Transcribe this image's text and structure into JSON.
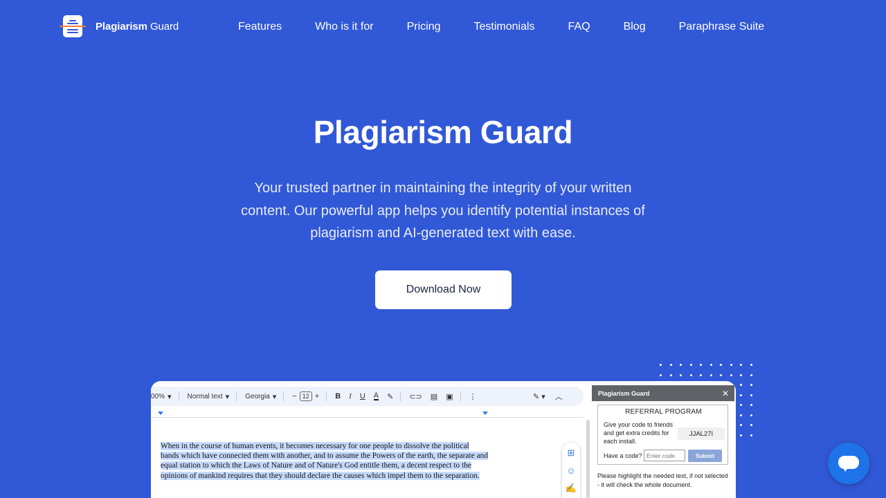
{
  "brand": {
    "name_bold": "Plagiarism",
    "name_light": "Guard"
  },
  "nav": [
    "Features",
    "Who is it for",
    "Pricing",
    "Testimonials",
    "FAQ",
    "Blog",
    "Paraphrase Suite"
  ],
  "hero": {
    "title": "Plagiarism Guard",
    "subtitle": "Your trusted partner in maintaining the integrity of your written content. Our powerful app helps you identify potential instances of plagiarism and AI-generated text with ease.",
    "cta": "Download Now"
  },
  "preview": {
    "toolbar": {
      "zoom": "00%",
      "style": "Normal text",
      "font": "Georgia",
      "size": "12"
    },
    "doc_text": "When in the course of human events, it becomes necessary for one people to dissolve the political bands which have connected them with another, and to assume the Powers of the earth, the separate and equal station to which the Laws of Nature and of Nature's God entitle them, a decent respect to the opinions of mankind requires that they should declare the causes which impel them to the separation.",
    "panel": {
      "title": "Plagiarism Guard",
      "close": "✕",
      "referral_title": "REFERRAL PROGRAM",
      "referral_desc": "Give your code to friends and get extra credits for each install.",
      "code": "JJAL27I",
      "have_code": "Have a code?",
      "input_placeholder": "Enter code",
      "submit": "Submit",
      "note": "Please highlight the needed text, if not selected - it will check the whole document."
    }
  },
  "colors": {
    "background": "#3158d6",
    "cta_bg": "#ffffff",
    "chat": "#1f73e8",
    "highlight": "#c6dafc"
  }
}
